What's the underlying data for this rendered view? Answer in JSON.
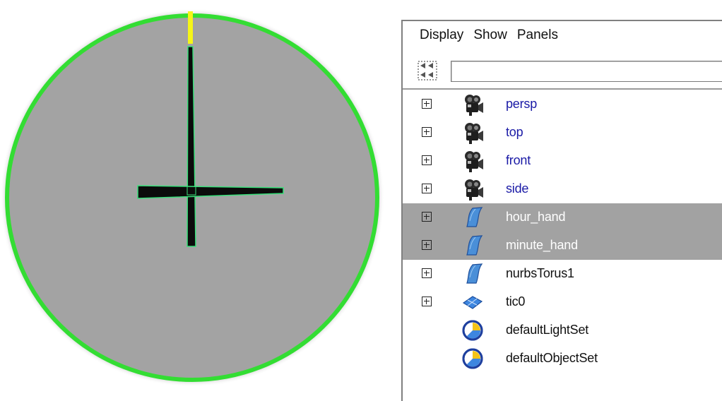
{
  "colors": {
    "clock_ring": "#33dd33",
    "clock_face": "#a3a3a3",
    "hand": "#0b0b0b",
    "hand_outline": "#39e07a",
    "top_marker": "#f5f517",
    "selection": "#a2a2a2",
    "camera_label": "#1a1aa6"
  },
  "outliner": {
    "menu": [
      "Display",
      "Show",
      "Panels"
    ],
    "filter_value": "",
    "items": [
      {
        "label": "persp",
        "icon": "camera-icon",
        "expandable": true,
        "selected": false,
        "camera": true
      },
      {
        "label": "top",
        "icon": "camera-icon",
        "expandable": true,
        "selected": false,
        "camera": true
      },
      {
        "label": "front",
        "icon": "camera-icon",
        "expandable": true,
        "selected": false,
        "camera": true
      },
      {
        "label": "side",
        "icon": "camera-icon",
        "expandable": true,
        "selected": false,
        "camera": true
      },
      {
        "label": "hour_hand",
        "icon": "nurbs-surface-icon",
        "expandable": true,
        "selected": true,
        "camera": false
      },
      {
        "label": "minute_hand",
        "icon": "nurbs-surface-icon",
        "expandable": true,
        "selected": true,
        "camera": false
      },
      {
        "label": "nurbsTorus1",
        "icon": "nurbs-surface-icon",
        "expandable": true,
        "selected": false,
        "camera": false
      },
      {
        "label": "tic0",
        "icon": "poly-mesh-icon",
        "expandable": true,
        "selected": false,
        "camera": false
      },
      {
        "label": "defaultLightSet",
        "icon": "set-icon",
        "expandable": false,
        "selected": false,
        "camera": false
      },
      {
        "label": "defaultObjectSet",
        "icon": "set-icon",
        "expandable": false,
        "selected": false,
        "camera": false
      }
    ]
  }
}
